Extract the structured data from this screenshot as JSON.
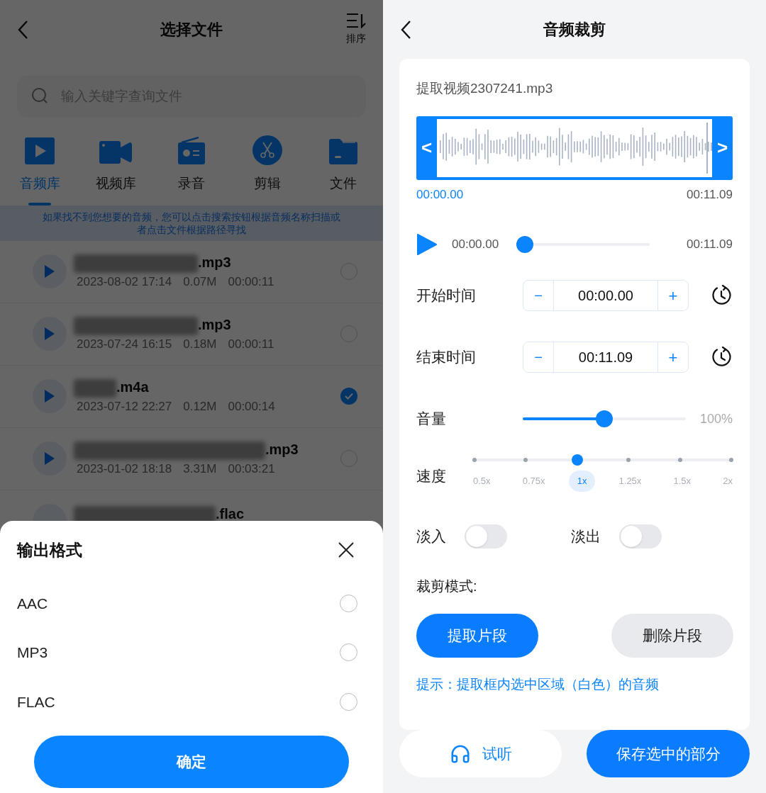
{
  "left": {
    "header": {
      "title": "选择文件",
      "sort_label": "排序"
    },
    "search": {
      "placeholder": "输入关键字查询文件"
    },
    "categories": [
      {
        "label": "音频库",
        "kind": "audio",
        "selected": true
      },
      {
        "label": "视频库",
        "kind": "video",
        "selected": false
      },
      {
        "label": "录音",
        "kind": "record",
        "selected": false
      },
      {
        "label": "剪辑",
        "kind": "edit",
        "selected": false
      },
      {
        "label": "文件",
        "kind": "folder",
        "selected": false
      }
    ],
    "notice": "如果找不到您想要的音频，您可以点击搜索按钮根据音频名称扫描或者点击文件根据路径寻找",
    "files": [
      {
        "extension": ".mp3",
        "meta": [
          "2023-08-02 17:14",
          "0.07M",
          "00:00:11"
        ],
        "checked": false
      },
      {
        "extension": ".mp3",
        "meta": [
          "2023-07-24 16:15",
          "0.18M",
          "00:00:11"
        ],
        "checked": false
      },
      {
        "extension": ".m4a",
        "meta": [
          "2023-07-12 22:27",
          "0.12M",
          "00:00:14"
        ],
        "checked": true
      },
      {
        "extension": ".mp3",
        "meta": [
          "2023-01-02 18:18",
          "3.31M",
          "00:03:21"
        ],
        "checked": false
      },
      {
        "extension": ".flac"
      }
    ],
    "sheet": {
      "title": "输出格式",
      "options": [
        {
          "label": "AAC",
          "selected": false
        },
        {
          "label": "MP3",
          "selected": false
        },
        {
          "label": "FLAC",
          "selected": false
        }
      ],
      "confirm": "确定"
    }
  },
  "right": {
    "header": {
      "title": "音频裁剪"
    },
    "file_name": "提取视频2307241.mp3",
    "selection": {
      "start": "00:00.00",
      "end": "00:11.09",
      "left_handle": "<",
      "right_handle": ">"
    },
    "player": {
      "current": "00:00.00",
      "total": "00:11.09",
      "level": 0
    },
    "times": [
      {
        "label": "开始时间",
        "value": "00:00.00",
        "minus": "−",
        "plus": "+"
      },
      {
        "label": "结束时间",
        "value": "00:11.09",
        "minus": "−",
        "plus": "+"
      }
    ],
    "volume": {
      "label": "音量",
      "level": 0.5,
      "reading": "100%"
    },
    "speed": {
      "label": "速度",
      "options": [
        {
          "label": "0.5x",
          "selected": false
        },
        {
          "label": "0.75x",
          "selected": false
        },
        {
          "label": "1x",
          "selected": true
        },
        {
          "label": "1.25x",
          "selected": false
        },
        {
          "label": "1.5x",
          "selected": false
        },
        {
          "label": "2x",
          "selected": false
        }
      ]
    },
    "fades": [
      {
        "label": "淡入",
        "on": false
      },
      {
        "label": "淡出",
        "on": false
      }
    ],
    "mode": {
      "label": "裁剪模式:",
      "options": [
        {
          "label": "提取片段",
          "selected": true
        },
        {
          "label": "删除片段",
          "selected": false
        }
      ]
    },
    "hint": "提示：提取框内选中区域（白色）的音频",
    "actions": [
      {
        "label": "试听",
        "kind": "listen"
      },
      {
        "label": "保存选中的部分",
        "kind": "save"
      }
    ]
  }
}
